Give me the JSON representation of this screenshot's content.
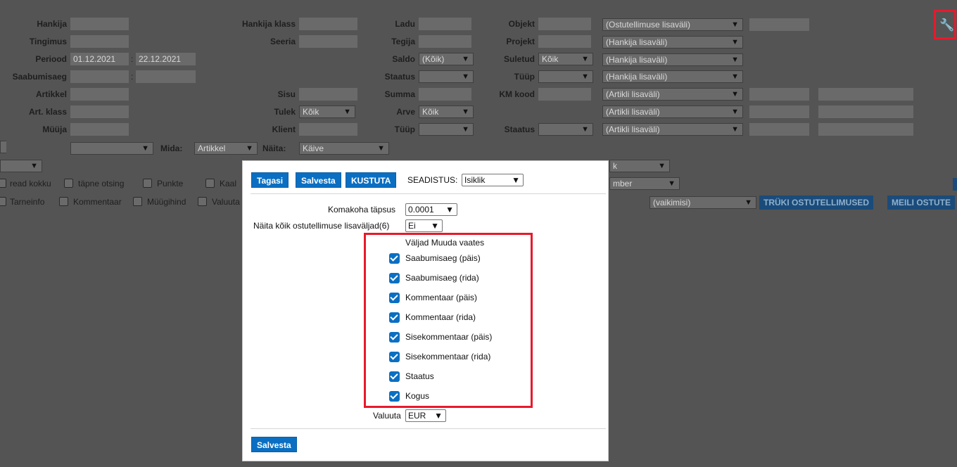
{
  "filters": {
    "hankija": "Hankija",
    "tingimus": "Tingimus",
    "periood": "Periood",
    "periood_from": "01.12.2021",
    "periood_sep": ":",
    "periood_to": "22.12.2021",
    "saabumisaeg": "Saabumisaeg",
    "saabumisaeg_sep": ":",
    "artikkel": "Artikkel",
    "art_klass": "Art. klass",
    "muuja": "Müüja",
    "hankija_klass": "Hankija klass",
    "seeria": "Seeria",
    "sisu": "Sisu",
    "tulek": "Tulek",
    "tulek_value": "Kõik",
    "klient": "Klient",
    "ladu": "Ladu",
    "tegija": "Tegija",
    "saldo": "Saldo",
    "saldo_value": "(Kõik)",
    "staatus": "Staatus",
    "summa": "Summa",
    "arve": "Arve",
    "arve_value": "Kõik",
    "tuup": "Tüüp",
    "objekt": "Objekt",
    "projekt": "Projekt",
    "suletud": "Suletud",
    "suletud_value": "Kõik",
    "tuup2": "Tüüp",
    "km_kood": "KM kood",
    "staatus2": "Staatus",
    "lisavali": [
      "(Ostutellimuse lisaväli)",
      "(Hankija lisaväli)",
      "(Hankija lisaväli)",
      "(Hankija lisaväli)",
      "(Artikli lisaväli)",
      "(Artikli lisaväli)",
      "(Artikli lisaväli)"
    ]
  },
  "options_row": {
    "mida_label": "Mida:",
    "mida_value": "Artikkel",
    "naita_label": "Näita:",
    "naita_value": "Käive",
    "right_sel_1": "k",
    "right_sel_2": "mber",
    "print_select": "(vaikimisi)",
    "print_button": "TRÜKI OSTUTELLIMUSED",
    "mail_button": "MEILI OSTUTE"
  },
  "checkboxes_bg": {
    "read_kokku": "read kokku",
    "tapne_otsing": "täpne otsing",
    "punkte": "Punkte",
    "kaal": "Kaal",
    "tarneinfo": "Tarneinfo",
    "kommentaar": "Kommentaar",
    "muugihind": "Müügihind",
    "valuuta": "Valuuta"
  },
  "modal": {
    "back_button": "Tagasi",
    "save_button": "Salvesta",
    "delete_button": "KUSTUTA",
    "settings_label": "SEADISTUS:",
    "settings_value": "Isiklik",
    "decimal_label": "Komakoha täpsus",
    "decimal_value": "0.0001",
    "show_fields_label": "Näita kõik ostutellimuse lisaväljad(6)",
    "show_fields_value": "Ei",
    "fields_title": "Väljad Muuda vaates",
    "fields": [
      {
        "label": "Saabumisaeg (päis)",
        "checked": true
      },
      {
        "label": "Saabumisaeg (rida)",
        "checked": true
      },
      {
        "label": "Kommentaar (päis)",
        "checked": true
      },
      {
        "label": "Kommentaar (rida)",
        "checked": true
      },
      {
        "label": "Sisekommentaar (päis)",
        "checked": true
      },
      {
        "label": "Sisekommentaar (rida)",
        "checked": true
      },
      {
        "label": "Staatus",
        "checked": true
      },
      {
        "label": "Kogus",
        "checked": true
      }
    ],
    "currency_label": "Valuuta",
    "currency_value": "EUR",
    "bottom_save_button": "Salvesta"
  },
  "colors": {
    "accent": "#0a6fc2",
    "highlight": "#e8192c",
    "overlay": "#545454"
  }
}
